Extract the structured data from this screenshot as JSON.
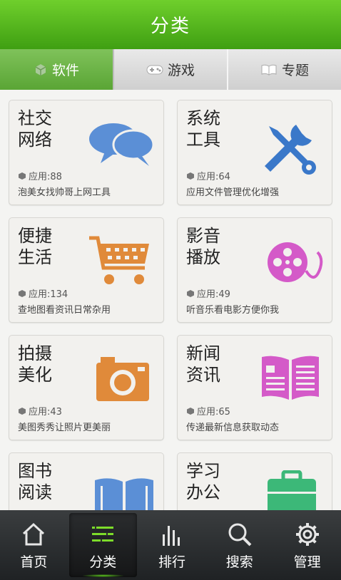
{
  "header": {
    "title": "分类"
  },
  "tabs": [
    {
      "label": "软件",
      "icon": "cube-icon",
      "active": true
    },
    {
      "label": "游戏",
      "icon": "gamepad-icon",
      "active": false
    },
    {
      "label": "专题",
      "icon": "book-icon",
      "active": false
    }
  ],
  "categories": [
    {
      "title": "社交网络",
      "icon": "chat-bubbles-icon",
      "count": "应用:88",
      "desc": "泡美女找帅哥上网工具",
      "color": "#5b8fd6"
    },
    {
      "title": "系统工具",
      "icon": "tools-icon",
      "count": "应用:64",
      "desc": "应用文件管理优化增强",
      "color": "#3a78c9"
    },
    {
      "title": "便捷生活",
      "icon": "shopping-cart-icon",
      "count": "应用:134",
      "desc": "查地图看资讯日常杂用",
      "color": "#e08a3a"
    },
    {
      "title": "影音播放",
      "icon": "film-reel-icon",
      "count": "应用:49",
      "desc": "听音乐看电影方便你我",
      "color": "#d45ac8"
    },
    {
      "title": "拍摄美化",
      "icon": "camera-icon",
      "count": "应用:43",
      "desc": "美图秀秀让照片更美丽",
      "color": "#e08a3a"
    },
    {
      "title": "新闻资讯",
      "icon": "newspaper-icon",
      "count": "应用:65",
      "desc": "传递最新信息获取动态",
      "color": "#d45ac8"
    },
    {
      "title": "图书阅读",
      "icon": "open-book-icon",
      "count": "",
      "desc": "",
      "color": "#5b8fd6"
    },
    {
      "title": "学习办公",
      "icon": "briefcase-icon",
      "count": "",
      "desc": "",
      "color": "#3cb878"
    }
  ],
  "bottom_nav": [
    {
      "label": "首页",
      "icon": "home-icon",
      "active": false
    },
    {
      "label": "分类",
      "icon": "list-icon",
      "active": true
    },
    {
      "label": "排行",
      "icon": "bar-chart-icon",
      "active": false
    },
    {
      "label": "搜索",
      "icon": "search-icon",
      "active": false
    },
    {
      "label": "管理",
      "icon": "gear-icon",
      "active": false
    }
  ]
}
